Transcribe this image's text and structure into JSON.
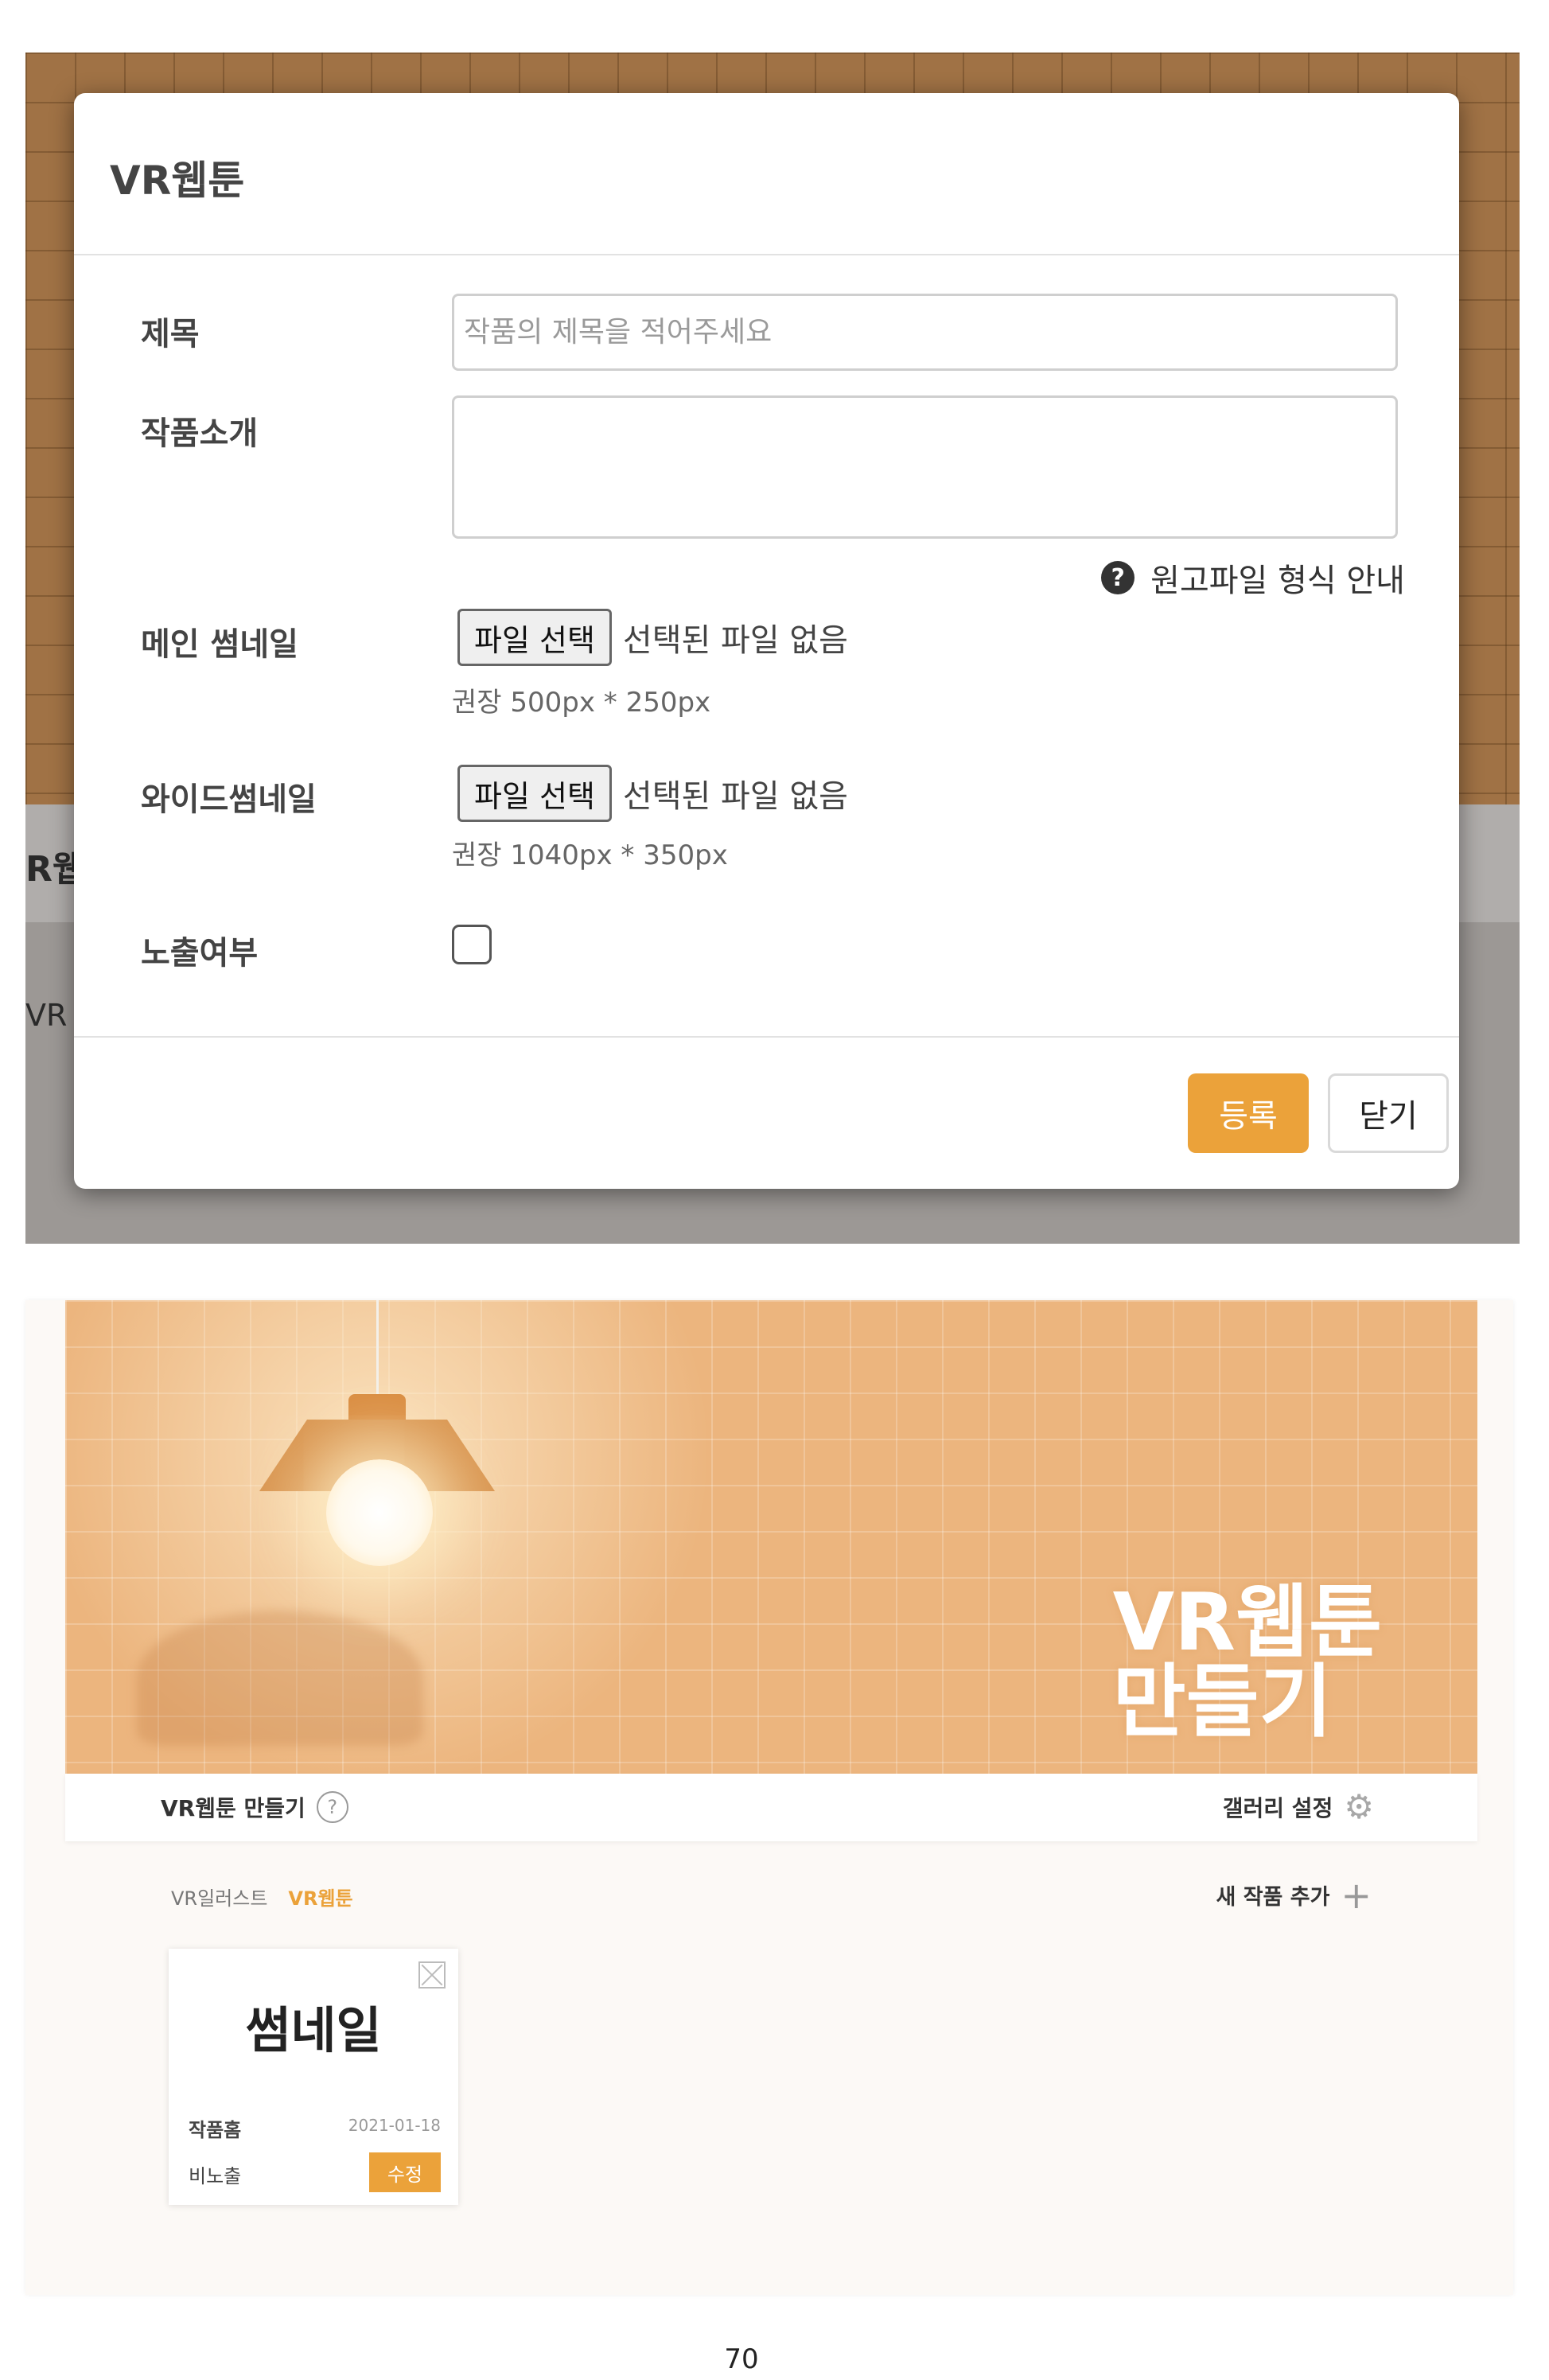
{
  "modal": {
    "title": "VR웹툰",
    "background_peek": [
      "R웹",
      "VR"
    ],
    "fields": {
      "title_label": "제목",
      "title_placeholder": "작품의 제목을 적어주세요",
      "intro_label": "작품소개",
      "intro_value": ""
    },
    "guide_link": "원고파일 형식 안내",
    "main_thumbnail": {
      "label": "메인 썸네일",
      "button": "파일 선택",
      "status": "선택된 파일 없음",
      "hint": "권장 500px * 250px"
    },
    "wide_thumbnail": {
      "label": "와이드썸네일",
      "button": "파일 선택",
      "status": "선택된 파일 없음",
      "hint": "권장 1040px * 350px"
    },
    "visibility": {
      "label": "노출여부",
      "checked": false
    },
    "submit_label": "등록",
    "close_label": "닫기",
    "colors": {
      "accent": "#eba23a"
    }
  },
  "gallery": {
    "hero_title_line1": "VR웹툰",
    "hero_title_line2": "만들기",
    "subbar_title": "VR웹툰 만들기",
    "help_icon": "question-circle-icon",
    "settings_label": "갤러리 설정",
    "settings_icon": "gear-icon",
    "breadcrumbs": [
      {
        "label": "VR일러스트",
        "active": false
      },
      {
        "label": "VR웹툰",
        "active": true
      }
    ],
    "new_work_label": "새 작품 추가",
    "card": {
      "thumbnail_text": "썸네일",
      "work_home": "작품홈",
      "date": "2021-01-18",
      "visibility": "비노출",
      "edit_label": "수정"
    }
  },
  "page_number": "70"
}
